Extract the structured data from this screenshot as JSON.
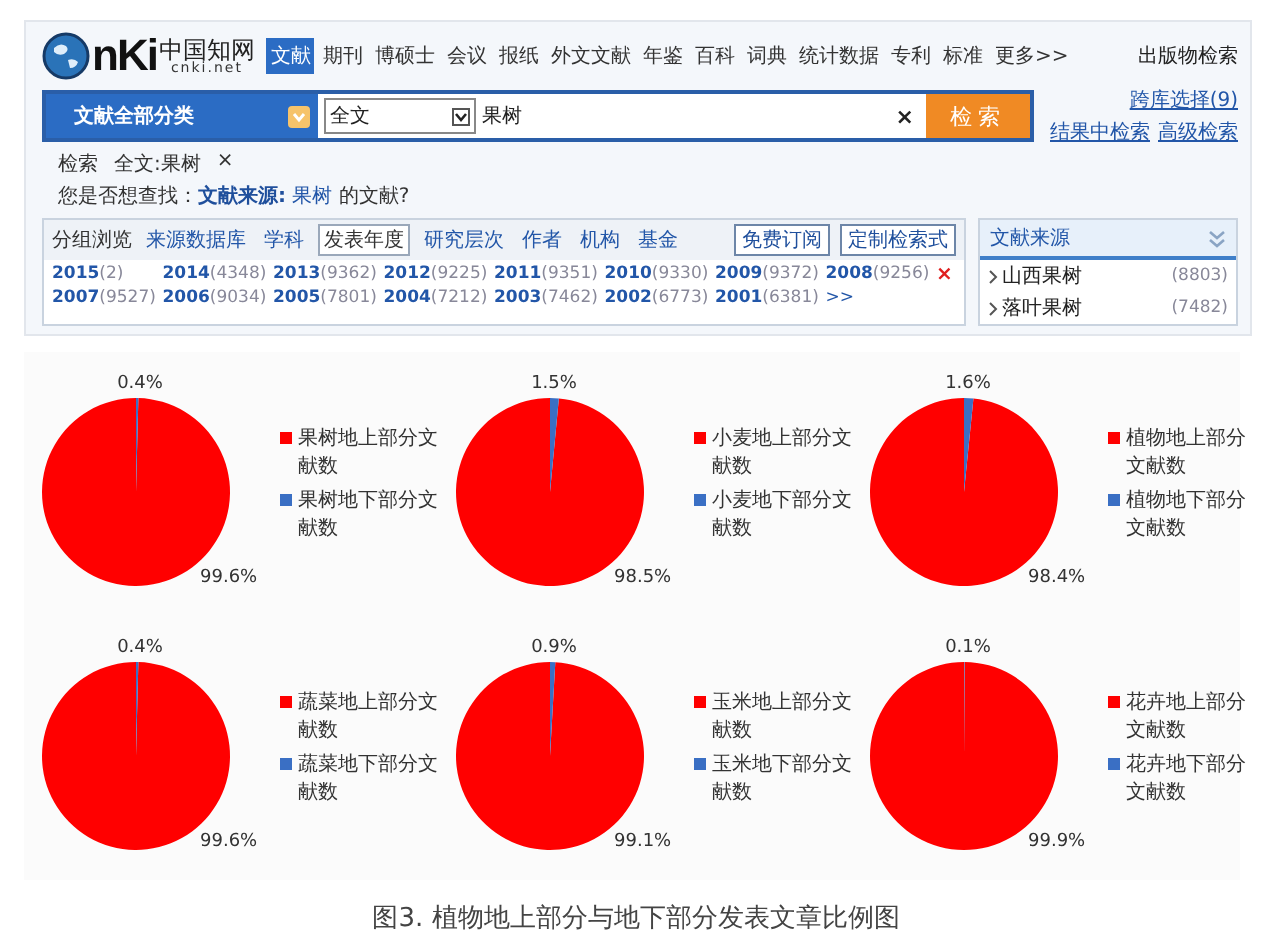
{
  "cnki": {
    "logo": {
      "mark": "nKi",
      "chinese": "中国知网",
      "domain": "cnki.net"
    },
    "nav_tabs": [
      {
        "label": "文献",
        "selected": true
      },
      {
        "label": "期刊",
        "selected": false
      },
      {
        "label": "博硕士",
        "selected": false
      },
      {
        "label": "会议",
        "selected": false
      },
      {
        "label": "报纸",
        "selected": false
      },
      {
        "label": "外文文献",
        "selected": false
      },
      {
        "label": "年鉴",
        "selected": false
      },
      {
        "label": "百科",
        "selected": false
      },
      {
        "label": "词典",
        "selected": false
      },
      {
        "label": "统计数据",
        "selected": false
      },
      {
        "label": "专利",
        "selected": false
      },
      {
        "label": "标准",
        "selected": false
      },
      {
        "label": "更多>>",
        "selected": false
      }
    ],
    "publication_search": "出版物检索",
    "category_dropdown": "文献全部分类",
    "field_select": "全文",
    "search_field": {
      "value": "果树"
    },
    "clear": "×",
    "search_button": "检索",
    "links": [
      "跨库选择(9)",
      "结果中检索",
      "高级检索"
    ],
    "breadcrumb": {
      "label": "检索",
      "term": "全文:果树",
      "remove": "×"
    },
    "suggestion": {
      "text": "您是否想查找：**文献来源:**",
      "link": "果树",
      "suffix": "的文献?"
    },
    "group_tabs": {
      "label": "分组浏览",
      "items": [
        {
          "label": "来源数据库",
          "selected": false
        },
        {
          "label": "学科",
          "selected": false
        },
        {
          "label": "发表年度",
          "selected": true
        },
        {
          "label": "研究层次",
          "selected": false
        },
        {
          "label": "作者",
          "selected": false
        },
        {
          "label": "机构",
          "selected": false
        },
        {
          "label": "基金",
          "selected": false
        }
      ]
    },
    "panel_buttons": [
      "免费订阅",
      "定制检索式"
    ],
    "years": [
      {
        "year": "2015",
        "count": "(2)"
      },
      {
        "year": "2014",
        "count": "(4348)"
      },
      {
        "year": "2013",
        "count": "(9362)"
      },
      {
        "year": "2012",
        "count": "(9225)"
      },
      {
        "year": "2011",
        "count": "(9351)"
      },
      {
        "year": "2010",
        "count": "(9330)"
      },
      {
        "year": "2009",
        "count": "(9372)"
      },
      {
        "year": "2008",
        "count": "(9256)"
      },
      {
        "year": "2007",
        "count": "(9527)"
      },
      {
        "year": "2006",
        "count": "(9034)"
      },
      {
        "year": "2005",
        "count": "(7801)"
      },
      {
        "year": "2004",
        "count": "(7212)"
      },
      {
        "year": "2003",
        "count": "(7462)"
      },
      {
        "year": "2002",
        "count": "(6773)"
      },
      {
        "year": "2001",
        "count": "(6381)"
      }
    ],
    "more": ">>",
    "close": "×",
    "source_panel": {
      "title": "文献来源",
      "items": [
        {
          "name": "山西果树",
          "count": "(8803)"
        },
        {
          "name": "落叶果树",
          "count": "(7482)"
        }
      ]
    }
  },
  "charts": [
    {
      "chart_data": {
        "type": "pie",
        "categories": [
          "果树地上部分文献数",
          "果树地下部分文献数"
        ],
        "values": [
          99.6,
          0.4
        ],
        "value_labels": [
          "99.6%",
          "0.4%"
        ]
      }
    },
    {
      "chart_data": {
        "type": "pie",
        "categories": [
          "小麦地上部分文献数",
          "小麦地下部分文献数"
        ],
        "values": [
          98.5,
          1.5
        ],
        "value_labels": [
          "98.5%",
          "1.5%"
        ]
      }
    },
    {
      "chart_data": {
        "type": "pie",
        "categories": [
          "植物地上部分文献数",
          "植物地下部分文献数"
        ],
        "values": [
          98.4,
          1.6
        ],
        "value_labels": [
          "98.4%",
          "1.6%"
        ]
      }
    },
    {
      "chart_data": {
        "type": "pie",
        "categories": [
          "蔬菜地上部分文献数",
          "蔬菜地下部分文献数"
        ],
        "values": [
          99.6,
          0.4
        ],
        "value_labels": [
          "99.6%",
          "0.4%"
        ]
      }
    },
    {
      "chart_data": {
        "type": "pie",
        "categories": [
          "玉米地上部分文献数",
          "玉米地下部分文献数"
        ],
        "values": [
          99.1,
          0.9
        ],
        "value_labels": [
          "99.1%",
          "0.9%"
        ]
      }
    },
    {
      "chart_data": {
        "type": "pie",
        "categories": [
          "花卉地上部分文献数",
          "花卉地下部分文献数"
        ],
        "values": [
          99.9,
          0.1
        ],
        "value_labels": [
          "99.9%",
          "0.1%"
        ]
      }
    }
  ],
  "caption": "图3.  植物地上部分与地下部分发表文章比例图"
}
